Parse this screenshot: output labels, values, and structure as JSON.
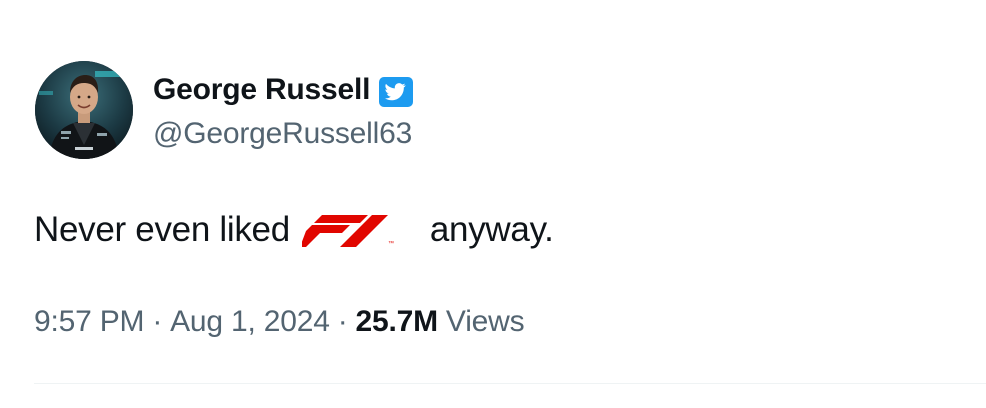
{
  "author": {
    "display_name": "George Russell",
    "handle": "@GeorgeRussell63",
    "verified_badge_icon": "verified-check-icon",
    "avatar_icon": "profile-photo"
  },
  "tweet": {
    "text_before_logo": "Never even liked",
    "logo": "f1-logo-icon",
    "text_after_logo": "anyway."
  },
  "meta": {
    "time": "9:57 PM",
    "separator_1": "·",
    "date": "Aug 1, 2024",
    "separator_2": "·",
    "views_count": "25.7M",
    "views_label": "Views"
  },
  "colors": {
    "text_primary": "#0f1419",
    "text_secondary": "#536471",
    "verified_blue": "#1d9bf0",
    "f1_red": "#e10600",
    "divider": "#eff3f4"
  }
}
